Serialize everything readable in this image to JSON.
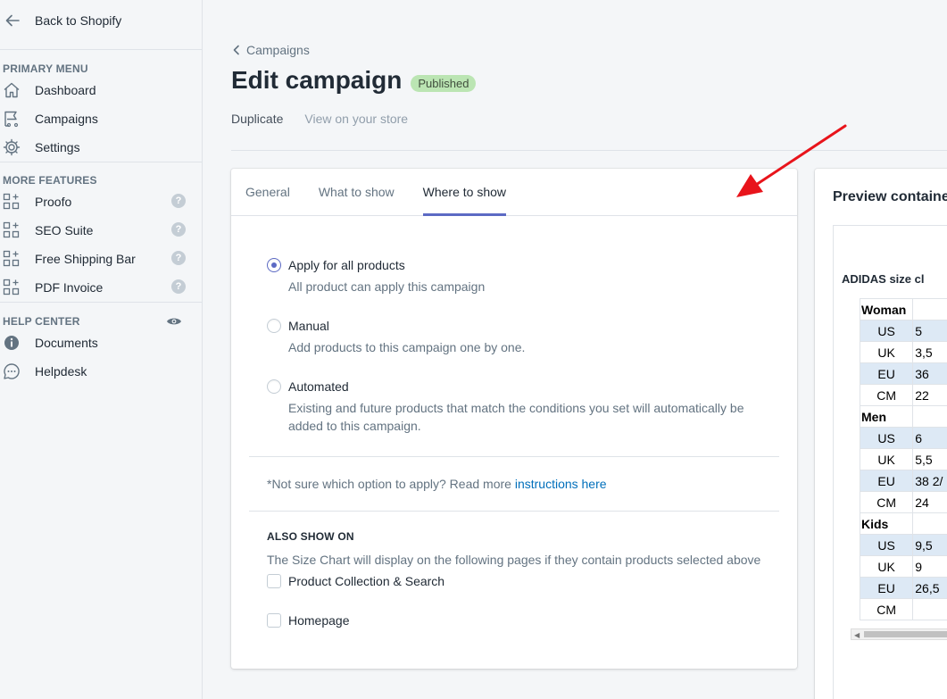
{
  "sidebar": {
    "back_label": "Back to Shopify",
    "primary_menu_title": "PRIMARY MENU",
    "primary_items": [
      {
        "label": "Dashboard",
        "icon": "home-icon"
      },
      {
        "label": "Campaigns",
        "icon": "flag-icon"
      },
      {
        "label": "Settings",
        "icon": "gear-icon"
      }
    ],
    "more_features_title": "MORE FEATURES",
    "feature_items": [
      {
        "label": "Proofo",
        "icon": "apps-add-icon"
      },
      {
        "label": "SEO Suite",
        "icon": "apps-add-icon"
      },
      {
        "label": "Free Shipping Bar",
        "icon": "apps-add-icon"
      },
      {
        "label": "PDF Invoice",
        "icon": "apps-add-icon"
      }
    ],
    "help_center_title": "HELP CENTER",
    "help_items": [
      {
        "label": "Documents",
        "icon": "info-icon"
      },
      {
        "label": "Helpdesk",
        "icon": "chat-icon"
      }
    ]
  },
  "page": {
    "breadcrumb": "Campaigns",
    "title": "Edit campaign",
    "status_badge": "Published",
    "action_duplicate": "Duplicate",
    "action_view_store": "View on your store"
  },
  "tabs": [
    {
      "label": "General",
      "active": false
    },
    {
      "label": "What to show",
      "active": false
    },
    {
      "label": "Where to show",
      "active": true
    }
  ],
  "options": [
    {
      "label": "Apply for all products",
      "desc": "All product can apply this campaign",
      "selected": true
    },
    {
      "label": "Manual",
      "desc": "Add products to this campaign one by one.",
      "selected": false
    },
    {
      "label": "Automated",
      "desc": "Existing and future products that match the conditions you set will automatically be added to this campaign.",
      "selected": false
    }
  ],
  "note": {
    "text": "*Not sure which option to apply? Read more ",
    "link": "instructions here"
  },
  "also_show": {
    "title": "ALSO SHOW ON",
    "desc": "The Size Chart will display on the following pages if they contain products selected above",
    "checkboxes": [
      {
        "label": "Product Collection & Search",
        "checked": false
      },
      {
        "label": "Homepage",
        "checked": false
      }
    ]
  },
  "preview": {
    "title": "Preview containe",
    "chart_title": "ADIDAS size cl",
    "groups": [
      {
        "name": "Woman",
        "rows": [
          [
            "US",
            "5"
          ],
          [
            "UK",
            "3,5"
          ],
          [
            "EU",
            "36"
          ],
          [
            "CM",
            "22"
          ]
        ]
      },
      {
        "name": "Men",
        "rows": [
          [
            "US",
            "6"
          ],
          [
            "UK",
            "5,5"
          ],
          [
            "EU",
            "38 2/"
          ],
          [
            "CM",
            "24"
          ]
        ]
      },
      {
        "name": "Kids",
        "rows": [
          [
            "US",
            "9,5"
          ],
          [
            "UK",
            "9"
          ],
          [
            "EU",
            "26,5"
          ],
          [
            "CM",
            ""
          ]
        ]
      }
    ]
  },
  "colors": {
    "accent": "#5c6ac4",
    "link": "#006fbb",
    "badge_bg": "#bbe5b3",
    "annotation_arrow": "#e8141b",
    "row_highlight": "#dde9f5"
  }
}
